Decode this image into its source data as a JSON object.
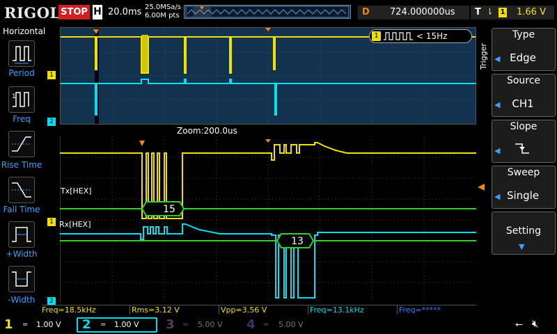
{
  "header": {
    "logo": "RIGOL",
    "run_state": "STOP",
    "timebase_label": "H",
    "timebase_value": "20.0ms",
    "sample_rate": "25.0MSa/s",
    "memory_depth": "6.00M pts",
    "delay_label": "D",
    "delay_value": "724.000000us",
    "trigger_label": "T",
    "trigger_channel": "1",
    "trigger_level": "1.66 V"
  },
  "left_panel": {
    "title": "Horizontal",
    "buttons": [
      {
        "label": "Period",
        "icon": "period-icon"
      },
      {
        "label": "Freq",
        "icon": "freq-icon"
      },
      {
        "label": "Rise Time",
        "icon": "rise-time-icon"
      },
      {
        "label": "Fall Time",
        "icon": "fall-time-icon"
      },
      {
        "label": "+Width",
        "icon": "plus-width-icon"
      },
      {
        "label": "-Width",
        "icon": "minus-width-icon"
      }
    ]
  },
  "overview": {
    "freq_badge_channel": "1",
    "freq_badge_text": "< 15Hz",
    "marker_ch1": "1",
    "marker_ch2": "2"
  },
  "zoom": {
    "label": "Zoom:200.0us",
    "tx_label": "Tx[HEX]",
    "rx_label": "Rx[HEX]",
    "tx_value": "15",
    "rx_value": "13",
    "marker_ch1": "1",
    "marker_ch2": "2"
  },
  "right_panel": {
    "vertical_title": "Trigger",
    "type_title": "Type",
    "type_value": "Edge",
    "source_title": "Source",
    "source_value": "CH1",
    "slope_title": "Slope",
    "sweep_title": "Sweep",
    "sweep_value": "Single",
    "setting_title": "Setting"
  },
  "measurements": [
    {
      "text": "Freq=18.5kHz",
      "color": "#f0e000"
    },
    {
      "text": "Rms=3.12 V",
      "color": "#f0e000"
    },
    {
      "text": "Vpp=3.56 V",
      "color": "#f0e000"
    },
    {
      "text": "Freq=13.1kHz",
      "color": "#00e0f0"
    },
    {
      "text": "Freq=*****",
      "color": "#3a7aff"
    }
  ],
  "channels": [
    {
      "num": "1",
      "coupling": "=",
      "scale": "1.00 V",
      "color": "#f0e000",
      "active": true
    },
    {
      "num": "2",
      "coupling": "=",
      "scale": "1.00 V",
      "color": "#00e0f0",
      "active": true
    },
    {
      "num": "3",
      "coupling": "=",
      "scale": "5.00 V",
      "color": "#d040d0",
      "active": false
    },
    {
      "num": "4",
      "coupling": "=",
      "scale": "5.00 V",
      "color": "#3a6aff",
      "active": false
    }
  ],
  "colors": {
    "ch1": "#f0e000",
    "ch2": "#00e0f0",
    "accent_blue": "#3aa0ff",
    "trigger_orange": "#f08a00",
    "decode_green": "#30d030"
  }
}
